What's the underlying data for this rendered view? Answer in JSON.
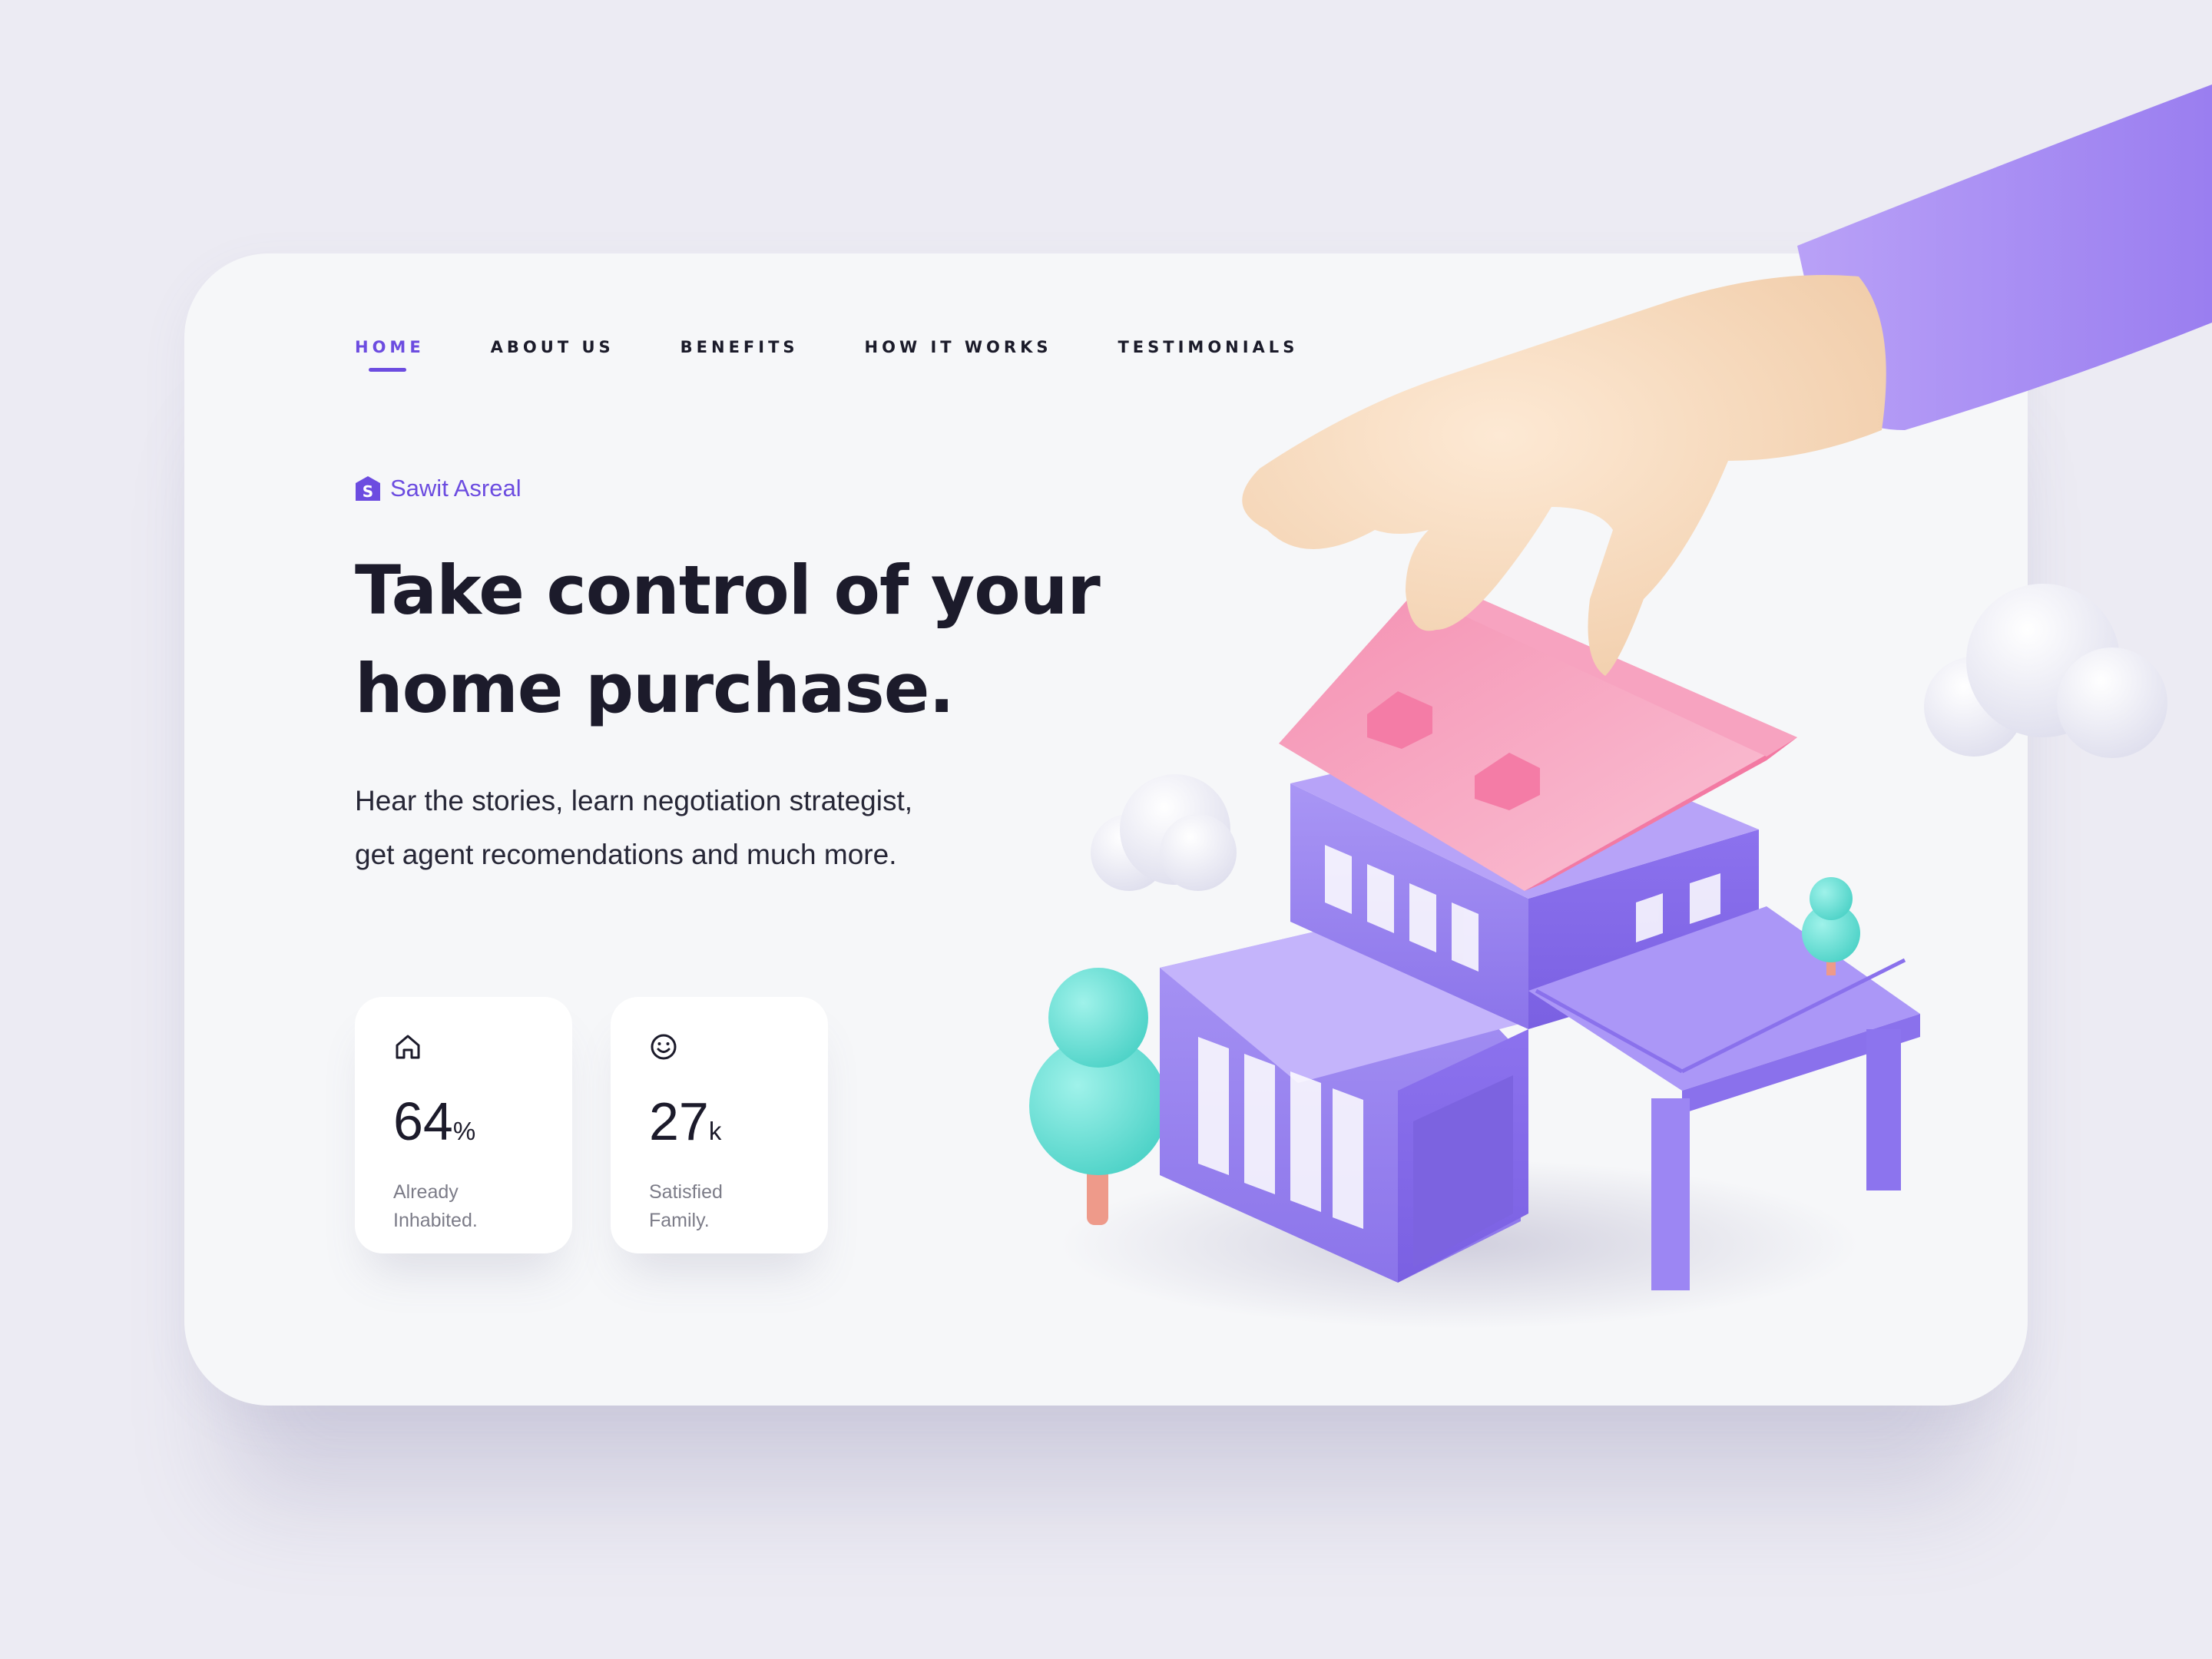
{
  "nav": {
    "items": [
      {
        "label": "HOME",
        "active": true
      },
      {
        "label": "ABOUT US",
        "active": false
      },
      {
        "label": "BENEFITS",
        "active": false
      },
      {
        "label": "HOW IT WORKS",
        "active": false
      },
      {
        "label": "TESTIMONIALS",
        "active": false
      }
    ]
  },
  "brand": {
    "name": "Sawit Asreal",
    "logo_letter": "S"
  },
  "hero": {
    "headline_line1": "Take control of your",
    "headline_line2": "home purchase.",
    "description": "Hear the stories, learn negotiation strategist, get agent recomendations and much more."
  },
  "stats": [
    {
      "icon": "home-icon",
      "value": "64",
      "unit": "%",
      "label_line1": "Already",
      "label_line2": "Inhabited."
    },
    {
      "icon": "smile-icon",
      "value": "27",
      "unit": "k",
      "label_line1": "Satisfied",
      "label_line2": "Family."
    }
  ],
  "colors": {
    "accent": "#6c4ce0",
    "background": "#ecebf3",
    "card": "#f6f7f9",
    "house_wall": "#9b86f2",
    "roof": "#f7a6c2",
    "tree": "#6fe0d6",
    "skin": "#f7dcc0",
    "sleeve": "#a98cf5"
  }
}
